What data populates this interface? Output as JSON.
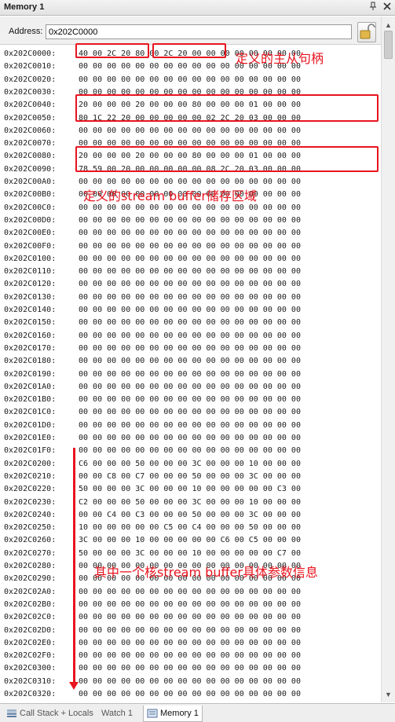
{
  "window": {
    "title": "Memory 1"
  },
  "address_bar": {
    "label": "Address:",
    "value": "0x202C0000"
  },
  "rows": [
    {
      "addr": "0x202C0000:",
      "bytes": "40 00 2C 20 80 00 2C 20 00 00 00 00 00 00 00 00"
    },
    {
      "addr": "0x202C0010:",
      "bytes": "00 00 00 00 00 00 00 00 00 00 00 00 00 00 00 00"
    },
    {
      "addr": "0x202C0020:",
      "bytes": "00 00 00 00 00 00 00 00 00 00 00 00 00 00 00 00"
    },
    {
      "addr": "0x202C0030:",
      "bytes": "00 00 00 00 00 00 00 00 00 00 00 00 00 00 00 00"
    },
    {
      "addr": "0x202C0040:",
      "bytes": "20 00 00 00 20 00 00 00 80 00 00 00 01 00 00 00"
    },
    {
      "addr": "0x202C0050:",
      "bytes": "80 1C 22 20 00 00 00 00 00 02 2C 20 03 00 00 00"
    },
    {
      "addr": "0x202C0060:",
      "bytes": "00 00 00 00 00 00 00 00 00 00 00 00 00 00 00 00"
    },
    {
      "addr": "0x202C0070:",
      "bytes": "00 00 00 00 00 00 00 00 00 00 00 00 00 00 00 00"
    },
    {
      "addr": "0x202C0080:",
      "bytes": "20 00 00 00 20 00 00 00 80 00 00 00 01 00 00 00"
    },
    {
      "addr": "0x202C0090:",
      "bytes": "78 59 00 20 00 00 00 00 00 08 2C 20 03 00 00 00"
    },
    {
      "addr": "0x202C00A0:",
      "bytes": "00 00 00 00 00 00 00 00 00 00 00 00 00 00 00 00"
    },
    {
      "addr": "0x202C00B0:",
      "bytes": "00 00 00 00 00 00 00 00 00 00 00 00 00 00 00 00"
    },
    {
      "addr": "0x202C00C0:",
      "bytes": "00 00 00 00 00 00 00 00 00 00 00 00 00 00 00 00"
    },
    {
      "addr": "0x202C00D0:",
      "bytes": "00 00 00 00 00 00 00 00 00 00 00 00 00 00 00 00"
    },
    {
      "addr": "0x202C00E0:",
      "bytes": "00 00 00 00 00 00 00 00 00 00 00 00 00 00 00 00"
    },
    {
      "addr": "0x202C00F0:",
      "bytes": "00 00 00 00 00 00 00 00 00 00 00 00 00 00 00 00"
    },
    {
      "addr": "0x202C0100:",
      "bytes": "00 00 00 00 00 00 00 00 00 00 00 00 00 00 00 00"
    },
    {
      "addr": "0x202C0110:",
      "bytes": "00 00 00 00 00 00 00 00 00 00 00 00 00 00 00 00"
    },
    {
      "addr": "0x202C0120:",
      "bytes": "00 00 00 00 00 00 00 00 00 00 00 00 00 00 00 00"
    },
    {
      "addr": "0x202C0130:",
      "bytes": "00 00 00 00 00 00 00 00 00 00 00 00 00 00 00 00"
    },
    {
      "addr": "0x202C0140:",
      "bytes": "00 00 00 00 00 00 00 00 00 00 00 00 00 00 00 00"
    },
    {
      "addr": "0x202C0150:",
      "bytes": "00 00 00 00 00 00 00 00 00 00 00 00 00 00 00 00"
    },
    {
      "addr": "0x202C0160:",
      "bytes": "00 00 00 00 00 00 00 00 00 00 00 00 00 00 00 00"
    },
    {
      "addr": "0x202C0170:",
      "bytes": "00 00 00 00 00 00 00 00 00 00 00 00 00 00 00 00"
    },
    {
      "addr": "0x202C0180:",
      "bytes": "00 00 00 00 00 00 00 00 00 00 00 00 00 00 00 00"
    },
    {
      "addr": "0x202C0190:",
      "bytes": "00 00 00 00 00 00 00 00 00 00 00 00 00 00 00 00"
    },
    {
      "addr": "0x202C01A0:",
      "bytes": "00 00 00 00 00 00 00 00 00 00 00 00 00 00 00 00"
    },
    {
      "addr": "0x202C01B0:",
      "bytes": "00 00 00 00 00 00 00 00 00 00 00 00 00 00 00 00"
    },
    {
      "addr": "0x202C01C0:",
      "bytes": "00 00 00 00 00 00 00 00 00 00 00 00 00 00 00 00"
    },
    {
      "addr": "0x202C01D0:",
      "bytes": "00 00 00 00 00 00 00 00 00 00 00 00 00 00 00 00"
    },
    {
      "addr": "0x202C01E0:",
      "bytes": "00 00 00 00 00 00 00 00 00 00 00 00 00 00 00 00"
    },
    {
      "addr": "0x202C01F0:",
      "bytes": "00 00 00 00 00 00 00 00 00 00 00 00 00 00 00 00"
    },
    {
      "addr": "0x202C0200:",
      "bytes": "C6 00 00 00 50 00 00 00 3C 00 00 00 10 00 00 00"
    },
    {
      "addr": "0x202C0210:",
      "bytes": "00 00 C8 00 C7 00 00 00 50 00 00 00 3C 00 00 00"
    },
    {
      "addr": "0x202C0220:",
      "bytes": "50 00 00 00 3C 00 00 00 10 00 00 00 00 00 C3 00"
    },
    {
      "addr": "0x202C0230:",
      "bytes": "C2 00 00 00 50 00 00 00 3C 00 00 00 10 00 00 00"
    },
    {
      "addr": "0x202C0240:",
      "bytes": "00 00 C4 00 C3 00 00 00 50 00 00 00 3C 00 00 00"
    },
    {
      "addr": "0x202C0250:",
      "bytes": "10 00 00 00 00 00 C5 00 C4 00 00 00 50 00 00 00"
    },
    {
      "addr": "0x202C0260:",
      "bytes": "3C 00 00 00 10 00 00 00 00 00 C6 00 C5 00 00 00"
    },
    {
      "addr": "0x202C0270:",
      "bytes": "50 00 00 00 3C 00 00 00 10 00 00 00 00 00 C7 00"
    },
    {
      "addr": "0x202C0280:",
      "bytes": "00 00 00 00 00 00 00 00 00 00 00 00 00 00 00 00"
    },
    {
      "addr": "0x202C0290:",
      "bytes": "00 00 00 00 00 00 00 00 00 00 00 00 00 00 00 00"
    },
    {
      "addr": "0x202C02A0:",
      "bytes": "00 00 00 00 00 00 00 00 00 00 00 00 00 00 00 00"
    },
    {
      "addr": "0x202C02B0:",
      "bytes": "00 00 00 00 00 00 00 00 00 00 00 00 00 00 00 00"
    },
    {
      "addr": "0x202C02C0:",
      "bytes": "00 00 00 00 00 00 00 00 00 00 00 00 00 00 00 00"
    },
    {
      "addr": "0x202C02D0:",
      "bytes": "00 00 00 00 00 00 00 00 00 00 00 00 00 00 00 00"
    },
    {
      "addr": "0x202C02E0:",
      "bytes": "00 00 00 00 00 00 00 00 00 00 00 00 00 00 00 00"
    },
    {
      "addr": "0x202C02F0:",
      "bytes": "00 00 00 00 00 00 00 00 00 00 00 00 00 00 00 00"
    },
    {
      "addr": "0x202C0300:",
      "bytes": "00 00 00 00 00 00 00 00 00 00 00 00 00 00 00 00"
    },
    {
      "addr": "0x202C0310:",
      "bytes": "00 00 00 00 00 00 00 00 00 00 00 00 00 00 00 00"
    },
    {
      "addr": "0x202C0320:",
      "bytes": "00 00 00 00 00 00 00 00 00 00 00 00 00 00 00 00"
    },
    {
      "addr": "0x202C0330:",
      "bytes": "00 00 00 00 00 00 00 00 00 00 00 00 00 00 00 00"
    }
  ],
  "annotations": {
    "handles": "定义的主从句柄",
    "buffer_region": "定义的stream buffer储存区域",
    "one_core": "其中一个核stream buffer具体参数信息"
  },
  "tabs": [
    {
      "label": "Call Stack + Locals",
      "icon": "call-stack-icon",
      "active": false
    },
    {
      "label": "Watch 1",
      "icon": "watch-icon",
      "active": false
    },
    {
      "label": "Memory 1",
      "icon": "memory-icon",
      "active": true
    }
  ],
  "colors": {
    "annotation": "#e8141e",
    "tab_active_bg": "#ffffff",
    "window_bg": "#f0f0f0"
  },
  "icons": {
    "pin": "pin-icon",
    "close": "close-icon",
    "lock": "lock-icon"
  }
}
